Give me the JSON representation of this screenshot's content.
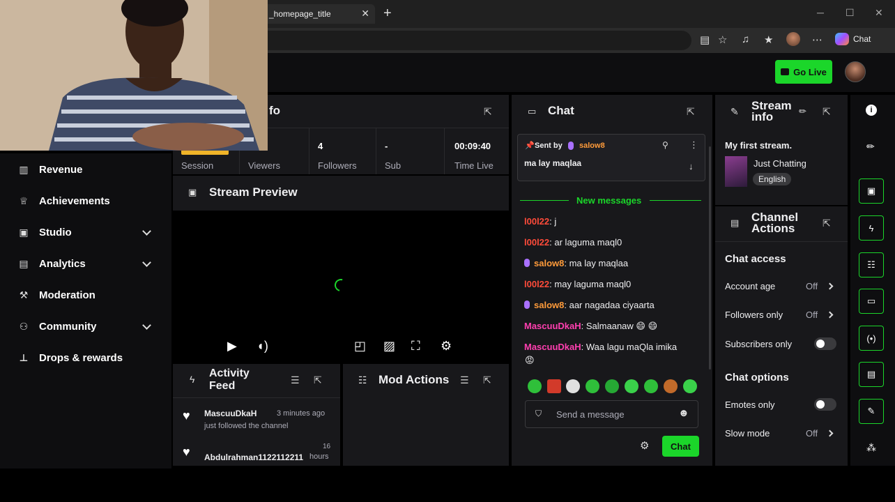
{
  "browser": {
    "tab_title": "_homepage_title",
    "tab_close": "✕",
    "new_tab": "+",
    "chat_label": "Chat",
    "window_controls": [
      "─",
      "☐",
      "✕"
    ]
  },
  "header": {
    "go_live_label": "Go Live"
  },
  "sidebar": {
    "items": [
      {
        "label": "Revenue",
        "icon": "revenue-icon",
        "glyph": "▥"
      },
      {
        "label": "Achievements",
        "icon": "trophy-icon",
        "glyph": "🏆"
      },
      {
        "label": "Studio",
        "icon": "studio-icon",
        "glyph": "▣"
      },
      {
        "label": "Analytics",
        "icon": "analytics-icon",
        "glyph": "▤"
      },
      {
        "label": "Moderation",
        "icon": "wrench-icon",
        "glyph": "🔧"
      },
      {
        "label": "Community",
        "icon": "community-icon",
        "glyph": "⚇"
      },
      {
        "label": "Drops & rewards",
        "icon": "drops-icon",
        "glyph": "⊥"
      }
    ]
  },
  "session": {
    "title_fragment": "fo",
    "stats": [
      {
        "value": "",
        "label": "Session"
      },
      {
        "value": "",
        "label": "Viewers"
      },
      {
        "value": "4",
        "label": "Followers"
      },
      {
        "value": "-",
        "label": "Sub"
      },
      {
        "value": "00:09:40",
        "label": "Time Live"
      }
    ]
  },
  "stream_preview": {
    "title": "Stream Preview"
  },
  "activity_feed": {
    "title_line1": "Activity",
    "title_line2": "Feed",
    "items": [
      {
        "user": "MascuuDkaH",
        "time": "3 minutes ago",
        "text": "just followed the channel"
      },
      {
        "user": "Abdulrahman1122112211",
        "time_num": "16",
        "time_unit": "hours"
      }
    ]
  },
  "mod_actions": {
    "title": "Mod Actions"
  },
  "chat": {
    "title": "Chat",
    "pinned": {
      "sent_by": "Sent by",
      "user": "salow8",
      "text": "ma lay maqlaa"
    },
    "new_messages": "New messages",
    "messages": [
      {
        "user": "l00l22",
        "text": ": j"
      },
      {
        "user": "l00l22",
        "text": ": ar laguma maql0"
      },
      {
        "user": "salow8",
        "text": ": ma lay maqlaa"
      },
      {
        "user": "l00l22",
        "text": ": may laguma maql0"
      },
      {
        "user": "salow8",
        "text": ": aar nagadaa ciyaarta"
      },
      {
        "user": "MascuuDkaH",
        "text": ": Salmaanaw 😄 😄"
      },
      {
        "user": "MascuuDkaH",
        "text": ": Waa lagu maQla imika"
      }
    ],
    "last_emoji": "😡",
    "send_placeholder": "Send a message",
    "chat_button": "Chat"
  },
  "stream_info": {
    "title_line1": "Stream",
    "title_line2": "info",
    "stream_title": "My first stream.",
    "category": "Just Chatting",
    "language": "English"
  },
  "channel_actions": {
    "title_line1": "Channel",
    "title_line2": "Actions",
    "chat_access": "Chat access",
    "account_age": "Account age",
    "followers_only": "Followers only",
    "subscribers_only": "Subscribers only",
    "chat_options": "Chat options",
    "emotes_only": "Emotes only",
    "slow_mode": "Slow mode",
    "off": "Off"
  },
  "colors": {
    "accent_green": "#1bd62a",
    "panel_bg": "#18181b",
    "app_bg": "#0e0e10"
  }
}
